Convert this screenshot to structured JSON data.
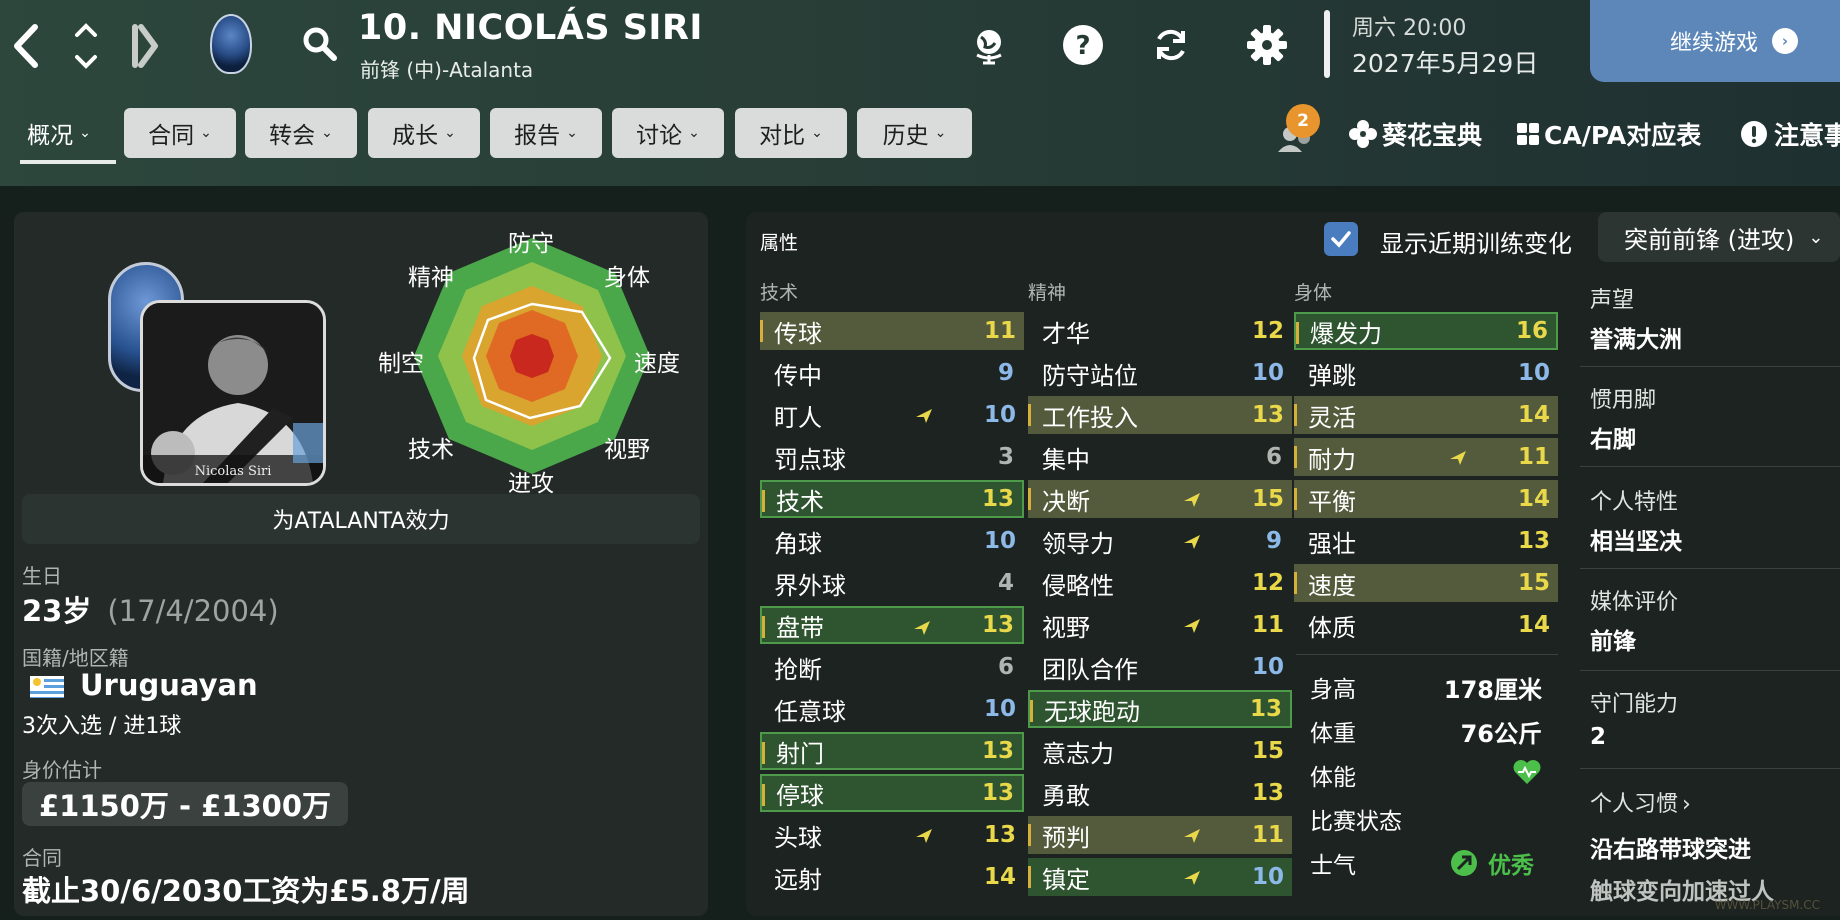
{
  "header": {
    "player_name": "10. NICOLÁS SIRI",
    "position_club": "前锋 (中)-Atalanta",
    "day_time": "周六 20:00",
    "date": "2027年5月29日",
    "continue_label": "继续游戏",
    "crest_text": "ATALANTA"
  },
  "tabs": [
    {
      "label": "概况"
    },
    {
      "label": "合同"
    },
    {
      "label": "转会"
    },
    {
      "label": "成长"
    },
    {
      "label": "报告"
    },
    {
      "label": "讨论"
    },
    {
      "label": "对比"
    },
    {
      "label": "历史"
    }
  ],
  "toolbar": {
    "scout_badge": "2",
    "guide_label": "葵花宝典",
    "capa_label": "CA/PA对应表",
    "notes_label": "注意事"
  },
  "profile": {
    "photo_caption": "Nicolas Siri",
    "plays_for": "为ATALANTA效力",
    "birth_label": "生日",
    "age": "23岁",
    "birth_date": "(17/4/2004)",
    "nationality_label": "国籍/地区籍",
    "nationality": "Uruguayan",
    "caps": "3次入选 / 进1球",
    "value_label": "身价估计",
    "value": "£1150万 - £1300万",
    "contract_label": "合同",
    "contract": "截止30/6/2030工资为£5.8万/周"
  },
  "radar": {
    "labels": [
      "防守",
      "身体",
      "速度",
      "视野",
      "进攻",
      "技术",
      "制空",
      "精神"
    ]
  },
  "attributes": {
    "panel_title": "属性",
    "show_training_label": "显示近期训练变化",
    "role": "突前前锋 (进攻)",
    "technical_header": "技术",
    "mental_header": "精神",
    "physical_header": "身体",
    "technical": [
      {
        "name": "传球",
        "value": "11",
        "hl": "y",
        "mark": true,
        "trend": false
      },
      {
        "name": "传中",
        "value": "9",
        "hl": "",
        "mark": false,
        "trend": false
      },
      {
        "name": "盯人",
        "value": "10",
        "hl": "",
        "mark": false,
        "trend": true
      },
      {
        "name": "罚点球",
        "value": "3",
        "hl": "",
        "mark": false,
        "trend": false
      },
      {
        "name": "技术",
        "value": "13",
        "hl": "g",
        "mark": true,
        "trend": false
      },
      {
        "name": "角球",
        "value": "10",
        "hl": "",
        "mark": false,
        "trend": false
      },
      {
        "name": "界外球",
        "value": "4",
        "hl": "",
        "mark": false,
        "trend": false
      },
      {
        "name": "盘带",
        "value": "13",
        "hl": "g",
        "mark": true,
        "trend": true
      },
      {
        "name": "抢断",
        "value": "6",
        "hl": "",
        "mark": false,
        "trend": false
      },
      {
        "name": "任意球",
        "value": "10",
        "hl": "",
        "mark": false,
        "trend": false
      },
      {
        "name": "射门",
        "value": "13",
        "hl": "g",
        "mark": true,
        "trend": false
      },
      {
        "name": "停球",
        "value": "13",
        "hl": "g",
        "mark": true,
        "trend": false
      },
      {
        "name": "头球",
        "value": "13",
        "hl": "",
        "mark": false,
        "trend": true
      },
      {
        "name": "远射",
        "value": "14",
        "hl": "",
        "mark": false,
        "trend": false
      }
    ],
    "mental": [
      {
        "name": "才华",
        "value": "12",
        "hl": "",
        "mark": false,
        "trend": false
      },
      {
        "name": "防守站位",
        "value": "10",
        "hl": "",
        "mark": false,
        "trend": false
      },
      {
        "name": "工作投入",
        "value": "13",
        "hl": "y",
        "mark": true,
        "trend": false
      },
      {
        "name": "集中",
        "value": "6",
        "hl": "",
        "mark": false,
        "trend": false
      },
      {
        "name": "决断",
        "value": "15",
        "hl": "y",
        "mark": true,
        "trend": true
      },
      {
        "name": "领导力",
        "value": "9",
        "hl": "",
        "mark": false,
        "trend": true
      },
      {
        "name": "侵略性",
        "value": "12",
        "hl": "",
        "mark": false,
        "trend": false
      },
      {
        "name": "视野",
        "value": "11",
        "hl": "",
        "mark": false,
        "trend": true
      },
      {
        "name": "团队合作",
        "value": "10",
        "hl": "",
        "mark": false,
        "trend": false
      },
      {
        "name": "无球跑动",
        "value": "13",
        "hl": "g",
        "mark": true,
        "trend": false
      },
      {
        "name": "意志力",
        "value": "15",
        "hl": "",
        "mark": false,
        "trend": false
      },
      {
        "name": "勇敢",
        "value": "13",
        "hl": "",
        "mark": false,
        "trend": false
      },
      {
        "name": "预判",
        "value": "11",
        "hl": "y",
        "mark": true,
        "trend": true
      },
      {
        "name": "镇定",
        "value": "10",
        "hl": "g2",
        "mark": true,
        "trend": true
      }
    ],
    "physical": [
      {
        "name": "爆发力",
        "value": "16",
        "hl": "g",
        "mark": true,
        "trend": false
      },
      {
        "name": "弹跳",
        "value": "10",
        "hl": "",
        "mark": false,
        "trend": false
      },
      {
        "name": "灵活",
        "value": "14",
        "hl": "y",
        "mark": true,
        "trend": false
      },
      {
        "name": "耐力",
        "value": "11",
        "hl": "y",
        "mark": true,
        "trend": true
      },
      {
        "name": "平衡",
        "value": "14",
        "hl": "y",
        "mark": true,
        "trend": false
      },
      {
        "name": "强壮",
        "value": "13",
        "hl": "",
        "mark": false,
        "trend": false
      },
      {
        "name": "速度",
        "value": "15",
        "hl": "y",
        "mark": true,
        "trend": false
      },
      {
        "name": "体质",
        "value": "14",
        "hl": "",
        "mark": false,
        "trend": false
      }
    ],
    "height_label": "身高",
    "height": "178厘米",
    "weight_label": "体重",
    "weight": "76公斤",
    "fitness_label": "体能",
    "form_label": "比赛状态",
    "morale_label": "士气",
    "morale": "优秀"
  },
  "side_info": {
    "reputation_label": "声望",
    "reputation": "誉满大洲",
    "foot_label": "惯用脚",
    "foot": "右脚",
    "personality_label": "个人特性",
    "personality": "相当坚决",
    "media_label": "媒体评价",
    "media": "前锋",
    "gk_label": "守门能力",
    "gk": "2",
    "habits_label": "个人习惯",
    "habit_1": "沿右路带球突进",
    "habit_2": "触球变向加速过人"
  },
  "watermark": "WWW.PLAYSM.CC",
  "colors": {
    "value_high": "#e8d84a",
    "value_mid": "#8db9e8",
    "value_low": "#b0b5b2",
    "highlight_yellow": "#545a3c",
    "highlight_green": "#2e5430",
    "accent_blue": "#5d87b9",
    "morale_green": "#4bbf4a"
  }
}
